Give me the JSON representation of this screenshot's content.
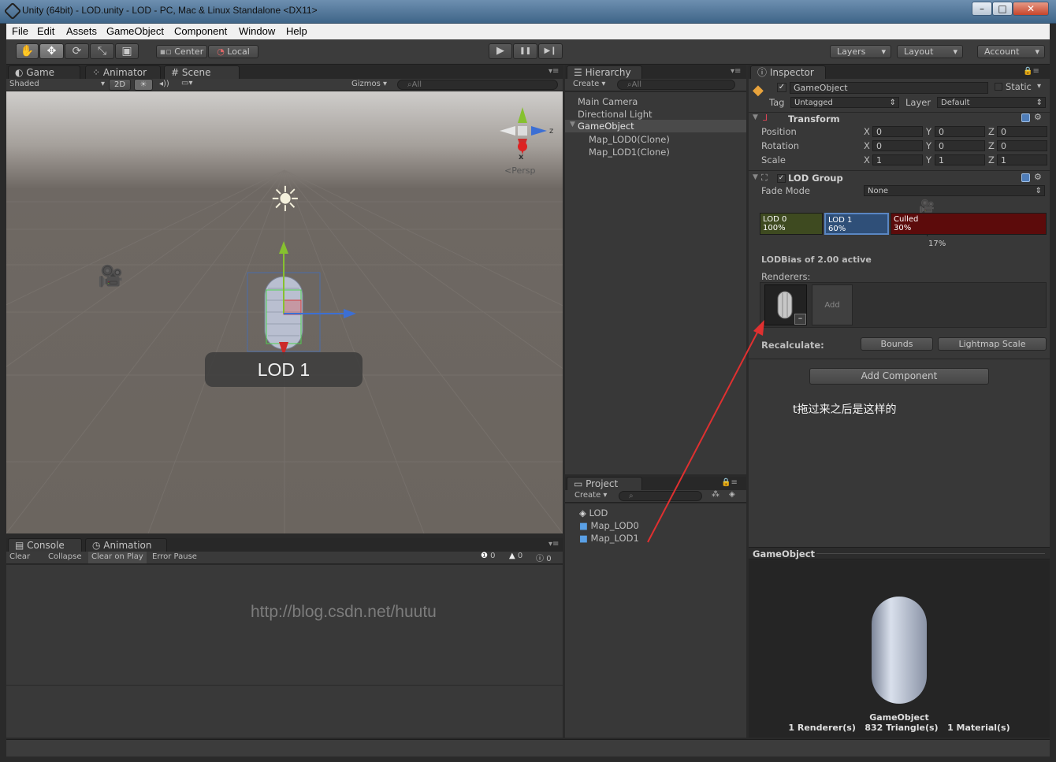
{
  "window": {
    "title": "Unity (64bit) - LOD.unity - LOD - PC, Mac & Linux Standalone <DX11>",
    "min": "–",
    "max": "□",
    "close": "✕"
  },
  "menu": [
    "File",
    "Edit",
    "Assets",
    "GameObject",
    "Component",
    "Window",
    "Help"
  ],
  "toolbar": {
    "tools": [
      "hand",
      "move",
      "rotate",
      "scale",
      "rect"
    ],
    "pivot": "Center",
    "space": "Local",
    "play": "▶",
    "pause": "❚❚",
    "step": "▶❙",
    "layers": "Layers",
    "layout": "Layout",
    "account": "Account"
  },
  "scene_panel": {
    "tabs": [
      "Game",
      "Animator",
      "Scene"
    ],
    "shading": "Shaded",
    "mode_2d": "2D",
    "gizmos": "Gizmos",
    "search_placeholder": "All",
    "persp": "Persp",
    "axis_x": "x",
    "axis_z": "z",
    "lod_label": "LOD 1"
  },
  "hierarchy": {
    "tab": "Hierarchy",
    "create": "Create",
    "search_placeholder": "All",
    "items": [
      "Main Camera",
      "Directional Light",
      "GameObject",
      "Map_LOD0(Clone)",
      "Map_LOD1(Clone)"
    ]
  },
  "project": {
    "tab": "Project",
    "create": "Create",
    "items": [
      "LOD",
      "Map_LOD0",
      "Map_LOD1"
    ]
  },
  "console": {
    "tabs": [
      "Console",
      "Animation"
    ],
    "buttons": [
      "Clear",
      "Collapse",
      "Clear on Play",
      "Error Pause"
    ],
    "counts": [
      "0",
      "0",
      "0"
    ],
    "watermark": "http://blog.csdn.net/huutu"
  },
  "inspector": {
    "tab": "Inspector",
    "object_name": "GameObject",
    "static": "Static",
    "tag_label": "Tag",
    "tag_value": "Untagged",
    "layer_label": "Layer",
    "layer_value": "Default",
    "transform": {
      "title": "Transform",
      "rows": [
        {
          "label": "Position",
          "x": "0",
          "y": "0",
          "z": "0"
        },
        {
          "label": "Rotation",
          "x": "0",
          "y": "0",
          "z": "0"
        },
        {
          "label": "Scale",
          "x": "1",
          "y": "1",
          "z": "1"
        }
      ],
      "axis": [
        "X",
        "Y",
        "Z"
      ]
    },
    "lod_group": {
      "title": "LOD Group",
      "fade_mode_label": "Fade Mode",
      "fade_mode_value": "None",
      "levels": [
        {
          "name": "LOD 0",
          "pct": "100%",
          "color": "#3e4a20"
        },
        {
          "name": "LOD 1",
          "pct": "60%",
          "color": "#2f4f78"
        },
        {
          "name": "Culled",
          "pct": "30%",
          "color": "#5c0b0b"
        }
      ],
      "camera_pct": "17%",
      "bias": "LODBias of 2.00 active",
      "renderers_label": "Renderers:",
      "add": "Add",
      "recalculate": "Recalculate:",
      "bounds": "Bounds",
      "lightmap_scale": "Lightmap Scale"
    },
    "add_component": "Add Component",
    "annotation": "t拖过来之后是这样的"
  },
  "preview": {
    "header": "GameObject",
    "name": "GameObject",
    "stats": "1 Renderer(s)   832 Triangle(s)   1 Material(s)"
  }
}
